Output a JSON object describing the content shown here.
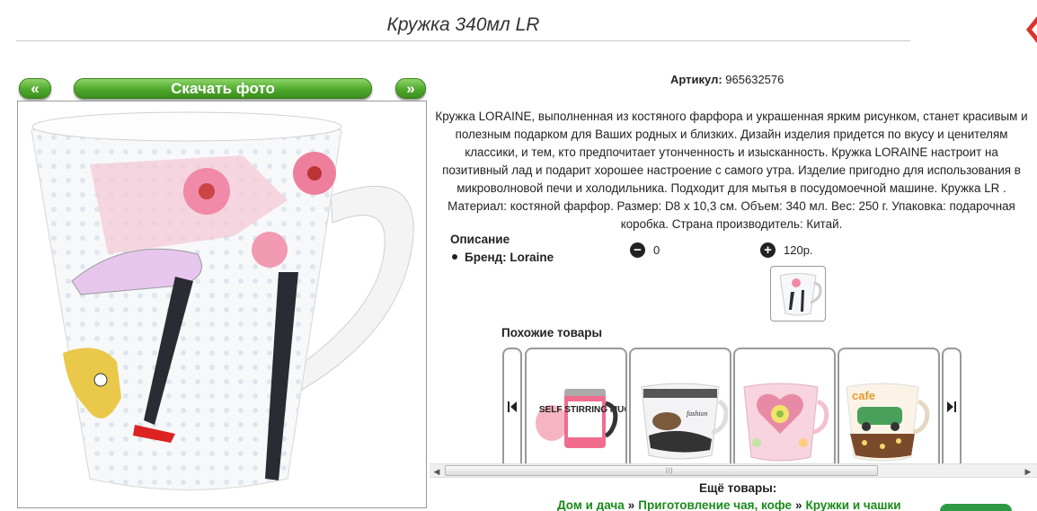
{
  "page": {
    "title": "Кружка 340мл LR"
  },
  "gallery": {
    "prev_label": "«",
    "download_label": "Скачать фото",
    "next_label": "»"
  },
  "product": {
    "sku_label": "Артикул:",
    "sku_value": "965632576",
    "description": "Кружка LORAINE, выполненная из костяного фарфора и украшенная ярким рисунком, станет красивым и полезным подарком для Ваших родных и близких. Дизайн изделия придется по вкусу и ценителям классики, и тем, кто предпочитает утонченность и изысканность. Кружка LORAINE настроит на позитивный лад и подарит хорошее настроение с самого утра. Изделие пригодно для использования в микроволновой печи и холодильника. Подходит для мытья в посудомоечной машине. Кружка LR . Материал: костяной фарфор. Размер: D8 х 10,3 см. Объем: 340 мл. Вес: 250 г. Упаковка: подарочная коробка. Страна производитель: Китай.",
    "specs_heading": "Описание",
    "brand_line": "Бренд: Loraine",
    "quantity": "0",
    "price": "120р."
  },
  "similar": {
    "heading": "Похожие товары",
    "items": [
      {
        "label": "SELF STIRRING MUG"
      },
      {
        "label": "fashion"
      },
      {
        "label": ""
      },
      {
        "label": "cafe"
      }
    ]
  },
  "more": {
    "heading": "Ещё товары:",
    "crumbs": [
      "Дом и дача",
      "Приготовление чая, кофе",
      "Кружки и чашки"
    ],
    "separator": "»"
  },
  "colors": {
    "accent_green": "#4ea82c",
    "link_green": "#1a8a1a",
    "close_red": "#d9342b"
  }
}
